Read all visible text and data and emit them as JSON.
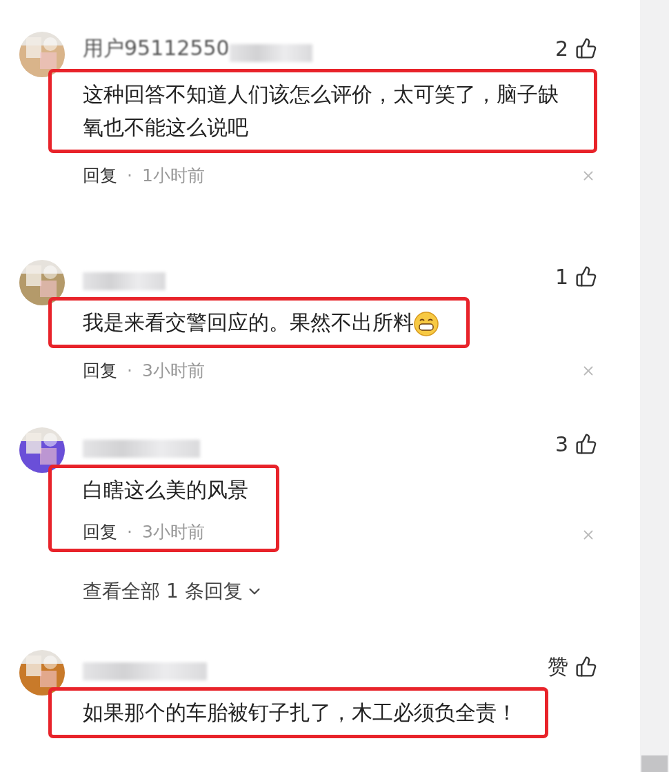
{
  "comments": [
    {
      "username": "用户95112550",
      "likes": "2",
      "text": "这种回答不知道人们该怎么评价，太可笑了，脑子缺氧也不能这么说吧",
      "reply": "回复",
      "separator": "·",
      "time": "1小时前",
      "highlighted": true,
      "highlight_includes_meta": false
    },
    {
      "likes": "1",
      "text": "我是来看交警回应的。果然不出所料",
      "emoji": true,
      "reply": "回复",
      "separator": "·",
      "time": "3小时前",
      "highlighted": true,
      "highlight_includes_meta": false
    },
    {
      "likes": "3",
      "text": "白瞎这么美的风景",
      "reply": "回复",
      "separator": "·",
      "time": "3小时前",
      "highlighted": true,
      "highlight_includes_meta": true,
      "replies_link": "查看全部 1 条回复"
    },
    {
      "likes": "赞",
      "text": "如果那个的车胎被钉子扎了，木工必须负全责！",
      "highlighted": true,
      "highlight_includes_meta": false
    }
  ]
}
